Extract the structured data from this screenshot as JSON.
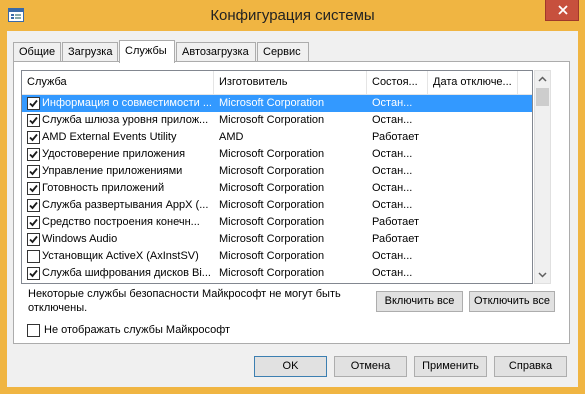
{
  "window": {
    "title": "Конфигурация системы"
  },
  "tabs": [
    {
      "label": "Общие"
    },
    {
      "label": "Загрузка"
    },
    {
      "label": "Службы"
    },
    {
      "label": "Автозагрузка"
    },
    {
      "label": "Сервис"
    }
  ],
  "active_tab": "Службы",
  "services": {
    "columns": [
      "Служба",
      "Изготовитель",
      "Состоя...",
      "Дата отключе..."
    ],
    "rows": [
      {
        "name": "Информация о совместимости ...",
        "vendor": "Microsoft Corporation",
        "status": "Остан...",
        "disabled_date": "",
        "checked": true,
        "selected": true
      },
      {
        "name": "Служба шлюза уровня прилож...",
        "vendor": "Microsoft Corporation",
        "status": "Остан...",
        "disabled_date": "",
        "checked": true,
        "selected": false
      },
      {
        "name": "AMD External Events Utility",
        "vendor": "AMD",
        "status": "Работает",
        "disabled_date": "",
        "checked": true,
        "selected": false
      },
      {
        "name": "Удостоверение приложения",
        "vendor": "Microsoft Corporation",
        "status": "Остан...",
        "disabled_date": "",
        "checked": true,
        "selected": false
      },
      {
        "name": "Управление приложениями",
        "vendor": "Microsoft Corporation",
        "status": "Остан...",
        "disabled_date": "",
        "checked": true,
        "selected": false
      },
      {
        "name": "Готовность приложений",
        "vendor": "Microsoft Corporation",
        "status": "Остан...",
        "disabled_date": "",
        "checked": true,
        "selected": false
      },
      {
        "name": "Служба развертывания AppX (...",
        "vendor": "Microsoft Corporation",
        "status": "Остан...",
        "disabled_date": "",
        "checked": true,
        "selected": false
      },
      {
        "name": "Средство построения конечн...",
        "vendor": "Microsoft Corporation",
        "status": "Работает",
        "disabled_date": "",
        "checked": true,
        "selected": false
      },
      {
        "name": "Windows Audio",
        "vendor": "Microsoft Corporation",
        "status": "Работает",
        "disabled_date": "",
        "checked": true,
        "selected": false
      },
      {
        "name": "Установщик ActiveX (AxInstSV)",
        "vendor": "Microsoft Corporation",
        "status": "Остан...",
        "disabled_date": "",
        "checked": false,
        "selected": false
      },
      {
        "name": "Служба шифрования дисков Bi...",
        "vendor": "Microsoft Corporation",
        "status": "Остан...",
        "disabled_date": "",
        "checked": true,
        "selected": false
      }
    ]
  },
  "note": "Некоторые службы безопасности Майкрософт не могут быть отключены.",
  "enable_all_label": "Включить все",
  "disable_all_label": "Отключить все",
  "hide_ms_label": "Не отображать службы Майкрософт",
  "hide_ms_checked": false,
  "buttons": {
    "ok": "OK",
    "cancel": "Отмена",
    "apply": "Применить",
    "help": "Справка"
  },
  "colors": {
    "frame": "#f0b542",
    "close": "#c7503d",
    "selection": "#3399ff",
    "face": "#f0f0f0"
  },
  "icons": {
    "app": "msconfig-app-icon",
    "close": "close-icon",
    "check": "check-icon",
    "scroll_up": "scroll-up-arrow-icon",
    "scroll_down": "scroll-down-arrow-icon"
  }
}
